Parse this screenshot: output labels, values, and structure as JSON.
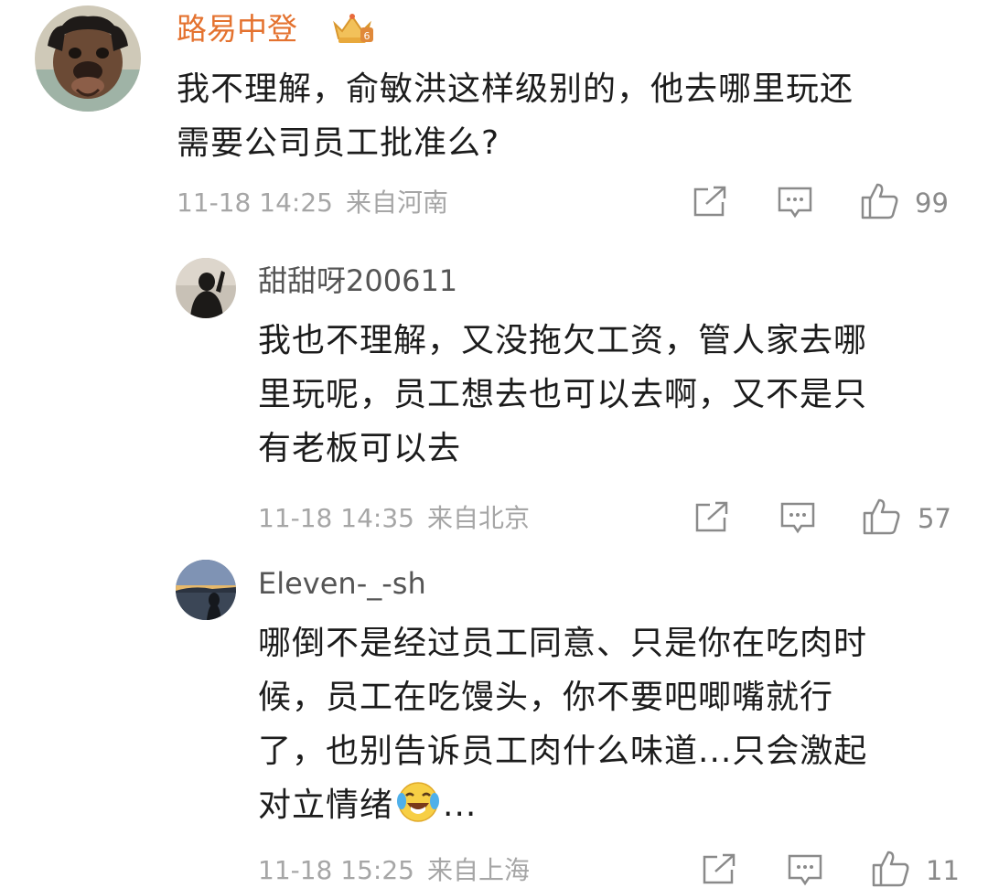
{
  "comments": [
    {
      "user": "路易中登",
      "avatar_icon": "bulldog-avatar",
      "badge_icon": "crown-badge-icon",
      "lines": [
        "我不理解，俞敏洪这样级别的，他去哪里玩还",
        "需要公司员工批准么?"
      ],
      "time": "11-18 14:25",
      "location": "来自河南",
      "likes": "99"
    },
    {
      "user": "甜甜呀200611",
      "avatar_icon": "silhouette-avatar",
      "lines": [
        "我也不理解，又没拖欠工资，管人家去哪",
        "里玩呢，员工想去也可以去啊，又不是只",
        "有老板可以去"
      ],
      "time": "11-18 14:35",
      "location": "来自北京",
      "likes": "57"
    },
    {
      "user": "Eleven-_-sh",
      "avatar_icon": "lake-sunset-avatar",
      "lines": [
        "哪倒不是经过员工同意、只是你在吃肉时",
        "候，员工在吃馒头，你不要吧唧嘴就行",
        "了，也别告诉员工肉什么味道...只会激起"
      ],
      "last_line_prefix": "对立情绪",
      "last_line_emoji": "laughing-crying-emoji",
      "last_line_suffix": "...",
      "time": "11-18 15:25",
      "location": "来自上海",
      "likes": "11"
    }
  ],
  "icons": {
    "share": "share-icon",
    "comment": "comment-icon",
    "like": "thumbs-up-icon"
  },
  "colors": {
    "username_top": "#e4722f",
    "meta_gray": "#a6a6a6",
    "icon_gray": "#8a8a8a"
  }
}
